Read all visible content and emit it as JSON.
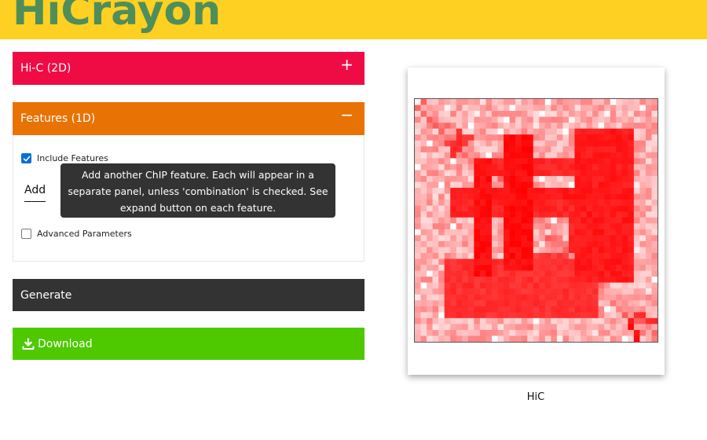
{
  "app": {
    "logo_text": "HiCrayon",
    "topbar_color": "#fdd022",
    "logo_color": "#4f8e5a"
  },
  "panels": {
    "hic": {
      "label": "Hi-C (2D)",
      "toggle_icon": "+",
      "color": "#ef0c45",
      "expanded": false
    },
    "features": {
      "label": "Features (1D)",
      "toggle_icon": "−",
      "color": "#e97204",
      "expanded": true,
      "include_features": {
        "label": "Include Features",
        "checked": true
      },
      "add_label": "Add",
      "advanced": {
        "label": "Advanced Parameters",
        "checked": false
      }
    }
  },
  "tooltip": {
    "lines": [
      "Add another ChIP feature. Each will appear in a",
      "separate panel, unless 'combination' is checked. See",
      "expand button on each feature."
    ]
  },
  "buttons": {
    "generate": {
      "label": "Generate",
      "color": "#333333"
    },
    "download": {
      "label": "Download",
      "icon": "download-icon",
      "color": "#4ec900"
    }
  },
  "plot": {
    "caption": "HiC",
    "colormap": {
      "low": "#ffffff",
      "high": "#ff0000"
    }
  }
}
